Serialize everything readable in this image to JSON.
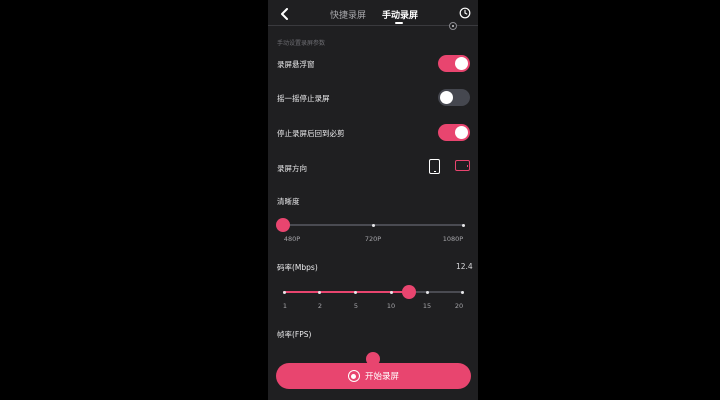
{
  "header": {
    "tabs": [
      {
        "label": "快捷录屏",
        "active": false
      },
      {
        "label": "手动录屏",
        "active": true
      }
    ],
    "icons": {
      "back": "back-arrow-icon",
      "history": "clock-icon"
    }
  },
  "section_hint": "手动设置录屏参数",
  "settings": {
    "floating_window": {
      "label": "录屏悬浮窗",
      "on": true
    },
    "shake_to_stop": {
      "label": "摇一摇停止录屏",
      "on": false
    },
    "return_after_stop": {
      "label": "停止录屏后回到必剪",
      "on": true
    },
    "orientation": {
      "label": "录屏方向",
      "selected": "landscape"
    }
  },
  "resolution": {
    "label": "清晰度",
    "ticks": [
      "480P",
      "720P",
      "1080P"
    ],
    "selected": "480P"
  },
  "bitrate": {
    "label": "码率(Mbps)",
    "value": "12.4",
    "ticks": [
      "1",
      "2",
      "5",
      "10",
      "15",
      "20"
    ]
  },
  "fps": {
    "label": "帧率(FPS)"
  },
  "start_button": {
    "label": "开始录屏"
  },
  "colors": {
    "accent": "#e8456f",
    "background": "#1f1f21",
    "toggle_off": "#45474f"
  }
}
